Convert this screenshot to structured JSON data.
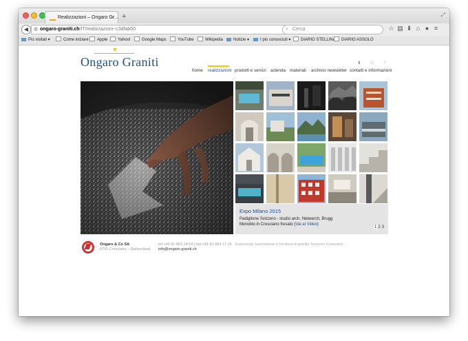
{
  "browser": {
    "tab_title": "Realizzazioni – Ongaro Gr…",
    "tab_close": "×",
    "new_tab": "+",
    "url_host": "ongaro-graniti.ch",
    "url_path": "/IT/realizzazioni~c3dfab00",
    "search_placeholder": "Cerca",
    "icons": [
      "star-icon",
      "bookmarks-list-icon",
      "download-icon",
      "home-icon",
      "chat-icon",
      "menu-icon"
    ],
    "bookmarks": [
      {
        "label": "Più visitati ▾",
        "type": "folder"
      },
      {
        "label": "Come iniziare",
        "type": "page"
      },
      {
        "label": "Apple",
        "type": "page"
      },
      {
        "label": "Yahoo!",
        "type": "page"
      },
      {
        "label": "Google Maps",
        "type": "page"
      },
      {
        "label": "YouTube",
        "type": "page"
      },
      {
        "label": "Wikipedia",
        "type": "page"
      },
      {
        "label": "Notizie ▾",
        "type": "folder"
      },
      {
        "label": "I più conosciuti ▾",
        "type": "folder"
      },
      {
        "label": "DIARIO STELLINA",
        "type": "page"
      },
      {
        "label": "DIARIO ASSOLO",
        "type": "page"
      }
    ]
  },
  "site": {
    "logo": "Ongaro Graniti",
    "languages": [
      "I",
      "D",
      "F"
    ],
    "active_language": "I",
    "nav": [
      "home",
      "realizzazioni",
      "prodotti e servizi",
      "azienda",
      "materiali",
      "archivio newsletter",
      "contatti e informazioni"
    ],
    "active_nav": "realizzazioni",
    "accent_color": "#f1c40f",
    "brand_color": "#1f4e8c"
  },
  "gallery": {
    "hero": "hand-touching-granite-surface",
    "thumbnails": [
      "pool",
      "building-facade",
      "dark-interior",
      "stone-rubble",
      "brick-building",
      "arched-corridor",
      "stone-wall-lake",
      "lake-mountain-view",
      "interior-wood",
      "modern-building",
      "white-chapel",
      "stone-arches",
      "blue-pool",
      "white-columns",
      "white-steps",
      "pool-night",
      "beige-wall",
      "red-apartment",
      "interior-hall",
      "stair-corner"
    ]
  },
  "caption": {
    "title": "Expo Milano 2015",
    "line1": "Padiglione Svizzero - studio arch. Netwerch, Brugg",
    "line2_text": "Monolito in Cresciano fresato (",
    "line2_link": "Vai al Video",
    "line2_end": ")",
    "pages": [
      "1",
      "2",
      "3"
    ],
    "current_page": "1"
  },
  "footer": {
    "company": "Ongaro & Co SA",
    "address": "6705 Cresciano – Switzerland",
    "phone": "tel +41 91 863 14 54 | fax +41 91 863 17 15",
    "email": "info@ongaro-graniti.ch",
    "description": "Estrazione, lavorazione e fornitura di granito Svizzero Cresciano"
  }
}
